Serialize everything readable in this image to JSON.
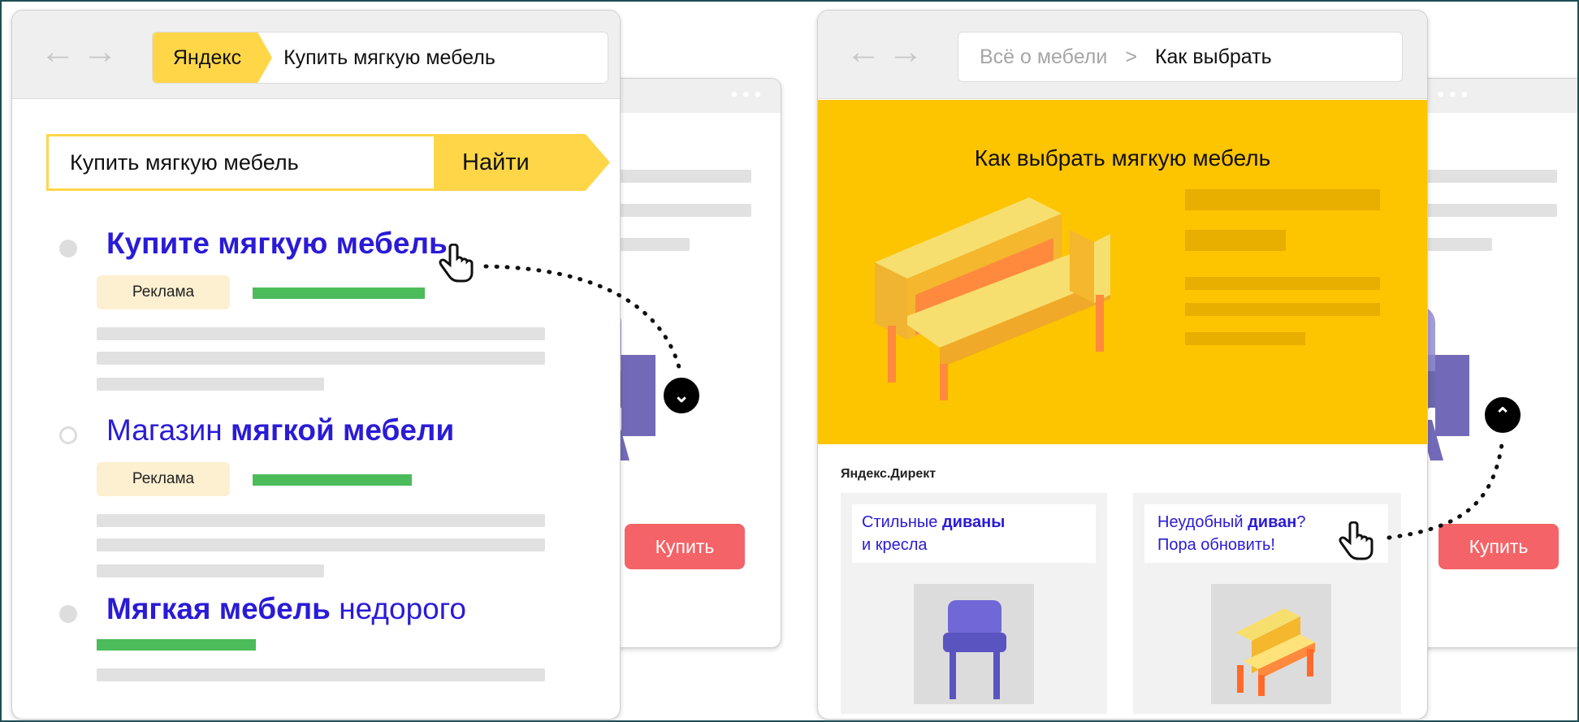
{
  "left_browser": {
    "brand_tab": "Яндекс",
    "address_query": "Купить мягкую мебель",
    "search": {
      "value": "Купить мягкую мебель",
      "button_label": "Найти"
    },
    "results": [
      {
        "title_bold": "Купите мягкую мебель",
        "title_rest": "",
        "badge": "Реклама"
      },
      {
        "title_plain": "Магазин ",
        "title_bold": "мягкой мебели",
        "badge": "Реклама"
      },
      {
        "title_bold": "Мягкая мебель",
        "title_rest": " недорого"
      }
    ]
  },
  "background_left_window": {
    "buy_label": "Купить"
  },
  "right_browser": {
    "breadcrumb_parent": "Всё о мебели",
    "breadcrumb_separator": ">",
    "breadcrumb_current": "Как выбрать",
    "hero_title": "Как выбрать мягкую мебель",
    "direct_label": "Яндекс.Директ",
    "ads": [
      {
        "line1_plain": "Стильные ",
        "line1_bold": "диваны",
        "line2": "и кресла"
      },
      {
        "line1_plain": "Неудобный ",
        "line1_bold": "диван",
        "line1_tail": "?",
        "line2": "Пора обновить!"
      }
    ]
  },
  "background_right_window": {
    "buy_label": "Купить"
  },
  "colors": {
    "brand_yellow": "#ffd648",
    "hero_yellow": "#fdc400",
    "link_blue": "#2a1bd6",
    "ad_green": "#4cbb5a",
    "buy_red": "#f46367"
  }
}
